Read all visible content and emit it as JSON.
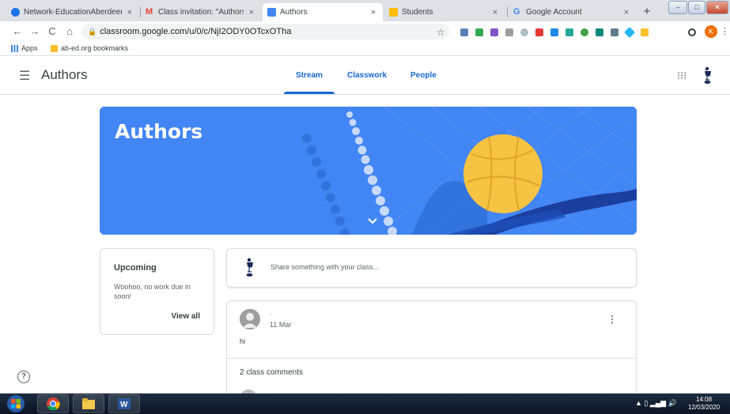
{
  "browser": {
    "tabs": [
      {
        "title": "Network-EducationAberdeen - ",
        "fav_color": "#1a73e8",
        "active": false
      },
      {
        "title": "Class invitation: \"Authors\" - gw",
        "fav_color": "#ea4335",
        "active": false
      },
      {
        "title": "Authors",
        "fav_color": "#4285f4",
        "active": true
      },
      {
        "title": "Students",
        "fav_color": "#fbbc04",
        "active": false
      },
      {
        "title": "Google Account",
        "fav_color": "#ffffff",
        "active": false
      }
    ],
    "gmail_glyph": "M",
    "google_glyph": "G",
    "close_glyph": "×",
    "new_tab_glyph": "+",
    "url": "classroom.google.com/u/0/c/NjI2ODY0OTcxOTha",
    "profile_initial": "K",
    "bookmarks": [
      {
        "label": "Apps",
        "icon": "apps-grid-icon"
      },
      {
        "label": "ab-ed.org bookmarks",
        "icon": "folder-icon"
      }
    ]
  },
  "classroom": {
    "class_name": "Authors",
    "tabs": [
      "Stream",
      "Classwork",
      "People"
    ],
    "active_tab": "Stream",
    "banner_title": "Authors",
    "upcoming": {
      "title": "Upcoming",
      "message": "Woohoo, no work due in soon!",
      "link": "View all"
    },
    "share_placeholder": "Share something with your class...",
    "post": {
      "author": "·",
      "date": "11 Mar",
      "body": "hi",
      "comments_label": "2 class comments"
    },
    "accent_color": "#1967d2",
    "banner_color": "#4285f4"
  },
  "taskbar": {
    "time": "14:08",
    "date": "12/03/2020"
  }
}
